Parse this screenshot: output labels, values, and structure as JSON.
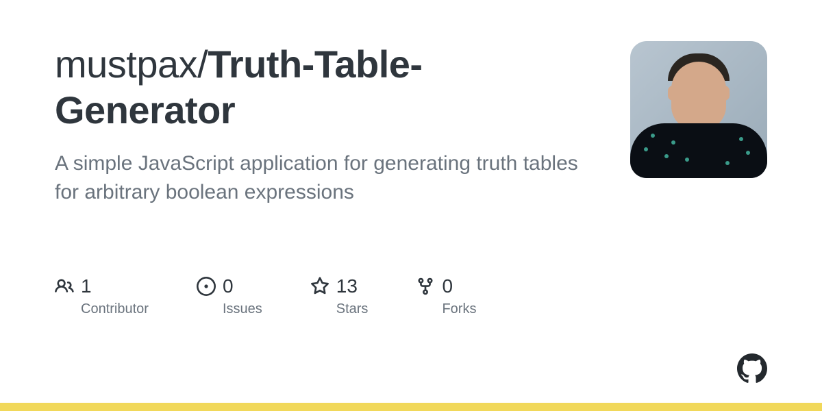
{
  "repo": {
    "owner": "mustpax",
    "name": "Truth-Table-Generator",
    "description": "A simple JavaScript application for generating truth tables for arbitrary boolean expressions"
  },
  "stats": {
    "contributors": {
      "value": "1",
      "label": "Contributor"
    },
    "issues": {
      "value": "0",
      "label": "Issues"
    },
    "stars": {
      "value": "13",
      "label": "Stars"
    },
    "forks": {
      "value": "0",
      "label": "Forks"
    }
  }
}
